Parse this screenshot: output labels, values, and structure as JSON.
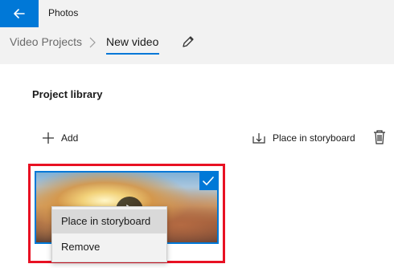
{
  "app": {
    "title": "Photos"
  },
  "breadcrumb": {
    "parent": "Video Projects",
    "current": "New video"
  },
  "section": {
    "title": "Project library"
  },
  "toolbar": {
    "add_label": "Add",
    "place_label": "Place in storyboard"
  },
  "context_menu": {
    "items": [
      "Place in storyboard",
      "Remove"
    ]
  },
  "icons": {
    "back": "back-arrow-icon",
    "edit": "pencil-icon",
    "add": "plus-icon",
    "place": "place-in-storyboard-icon",
    "delete": "trash-icon",
    "check": "checkmark-icon",
    "play": "play-icon"
  },
  "colors": {
    "accent": "#0078d7",
    "selection_border": "#e81123",
    "chrome": "#f2f2f2"
  },
  "state": {
    "thumbnail_selected": true,
    "context_menu_open": true
  }
}
